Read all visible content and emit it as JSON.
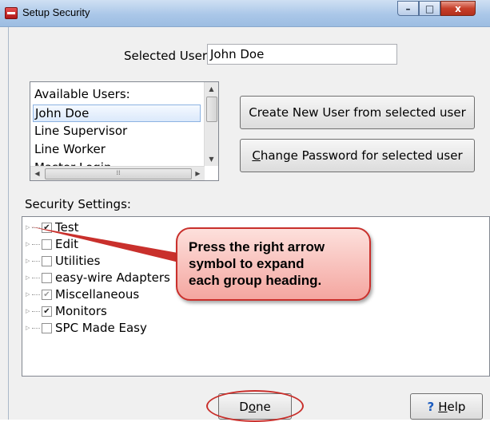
{
  "window": {
    "title": "Setup Security",
    "minimize_symbol": "–",
    "maximize_symbol": "□",
    "close_symbol": "x"
  },
  "selected_user": {
    "label": "Selected User:",
    "value": "John Doe"
  },
  "available_users": {
    "header": "Available Users:",
    "items": [
      "John Doe",
      "Line Supervisor",
      "Line Worker",
      "Master Login"
    ],
    "selected_index": 0
  },
  "buttons": {
    "create_user": "Create New User from selected user",
    "change_password": {
      "underlined": "C",
      "rest": "hange Password for selected user"
    },
    "done": {
      "before": "D",
      "underlined": "o",
      "after": "ne"
    },
    "help": {
      "icon": "?",
      "underlined": "H",
      "rest": "elp"
    }
  },
  "security_settings": {
    "label": "Security Settings:",
    "groups": [
      {
        "label": "Test",
        "state": "checked"
      },
      {
        "label": "Edit",
        "state": "unchecked"
      },
      {
        "label": "Utilities",
        "state": "unchecked"
      },
      {
        "label": "easy-wire Adapters",
        "state": "unchecked"
      },
      {
        "label": "Miscellaneous",
        "state": "partial"
      },
      {
        "label": "Monitors",
        "state": "checked"
      },
      {
        "label": "SPC Made Easy",
        "state": "unchecked"
      }
    ]
  },
  "callout": {
    "lines": [
      "Press the right arrow",
      "symbol to expand",
      "each group heading."
    ],
    "color": "#c9302c"
  },
  "colors": {
    "accent_red": "#c9302c",
    "titlebar": "#aac7e8",
    "selection": "#dbe9fb"
  }
}
